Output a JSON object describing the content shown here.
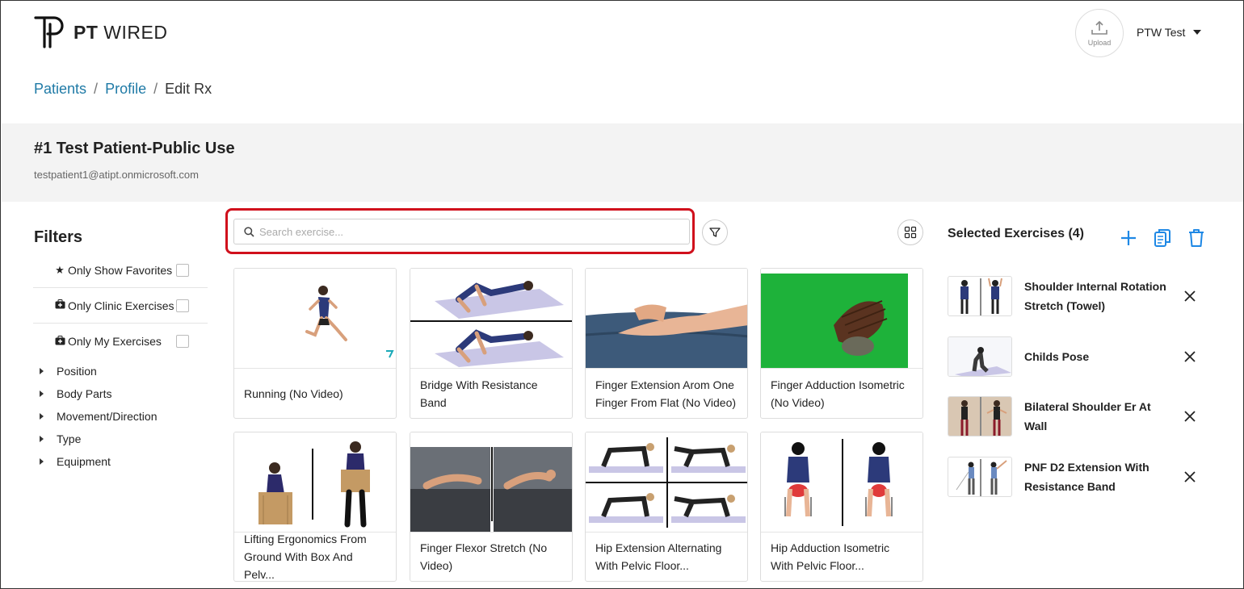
{
  "brand": {
    "logo_text_bold": "PT",
    "logo_text": "WIRED"
  },
  "header": {
    "upload_label": "Upload",
    "user_name": "PTW Test"
  },
  "breadcrumb": {
    "items": [
      "Patients",
      "Profile"
    ],
    "current": "Edit Rx",
    "separator": "/"
  },
  "patient": {
    "name": "#1 Test Patient-Public Use",
    "email": "testpatient1@atipt.onmicrosoft.com"
  },
  "filters": {
    "title": "Filters",
    "toggles": [
      {
        "label": "Only Show Favorites",
        "icon": "star-icon",
        "checked": false
      },
      {
        "label": "Only Clinic Exercises",
        "icon": "medkit-icon",
        "checked": false
      },
      {
        "label": "Only My Exercises",
        "icon": "medkit-icon",
        "checked": false
      }
    ],
    "categories": [
      "Position",
      "Body Parts",
      "Movement/Direction",
      "Type",
      "Equipment"
    ]
  },
  "search": {
    "placeholder": "Search exercise...",
    "value": ""
  },
  "exercises": [
    {
      "title": "Running (No Video)"
    },
    {
      "title": "Bridge With Resistance Band"
    },
    {
      "title": "Finger Extension Arom One Finger From Flat (No Video)"
    },
    {
      "title": "Finger Adduction Isometric (No Video)"
    },
    {
      "title": "Lifting Ergonomics From Ground With Box And Pelv..."
    },
    {
      "title": "Finger Flexor Stretch (No Video)"
    },
    {
      "title": "Hip Extension Alternating With Pelvic Floor..."
    },
    {
      "title": "Hip Adduction Isometric With Pelvic Floor..."
    }
  ],
  "selected": {
    "title": "Selected Exercises (4)",
    "items": [
      {
        "name": "Shoulder Internal Rotation Stretch (Towel)"
      },
      {
        "name": "Childs Pose"
      },
      {
        "name": "Bilateral Shoulder Er At Wall"
      },
      {
        "name": "PNF D2 Extension With Resistance Band"
      }
    ]
  },
  "colors": {
    "accent": "#1e88e5",
    "link": "#1f7aa6",
    "highlight": "#d0101c"
  }
}
